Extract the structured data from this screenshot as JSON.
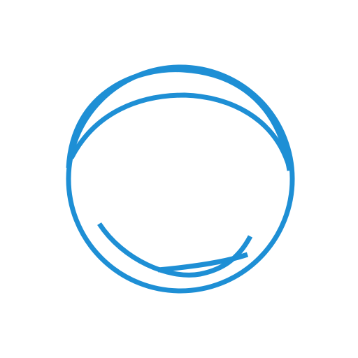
{
  "background_color": "#ffffff",
  "logo": {
    "icon": "looped-ring-icon",
    "stroke_color": "#1e8fd5"
  }
}
